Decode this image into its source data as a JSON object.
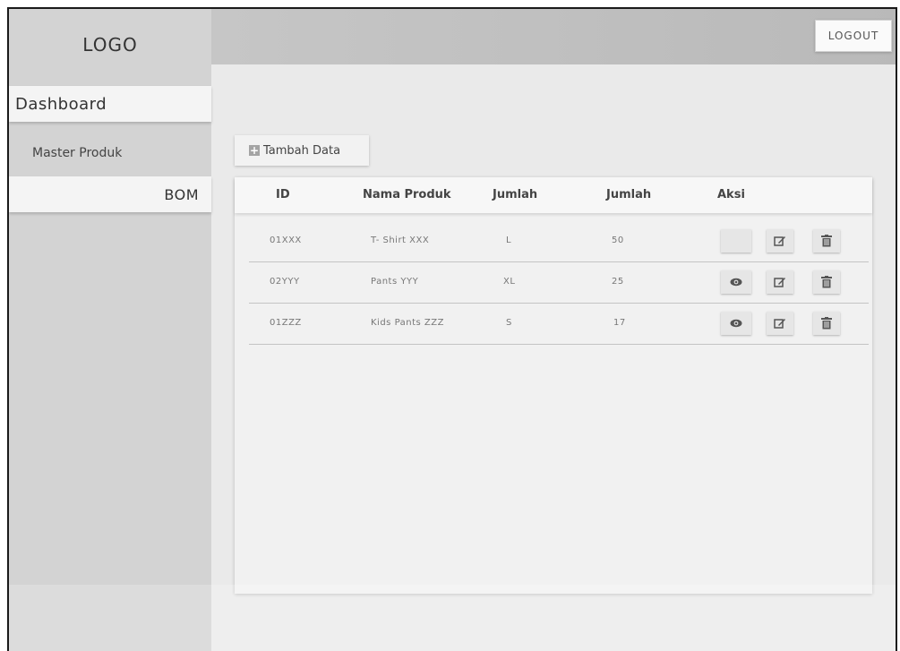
{
  "sidebar": {
    "logo": "LOGO",
    "items": [
      {
        "label": "Dashboard"
      },
      {
        "label": "Master Produk"
      },
      {
        "label": "BOM"
      }
    ]
  },
  "topbar": {
    "logout_label": "LOGOUT"
  },
  "toolbar": {
    "add_label": "Tambah Data",
    "add_icon": "plus-square-icon"
  },
  "table": {
    "columns": [
      "ID",
      "Nama Produk",
      "Jumlah",
      "Jumlah",
      "Aksi"
    ],
    "rows": [
      {
        "id": "01XXX",
        "name": "T- Shirt XXX",
        "size": "L",
        "qty": "50"
      },
      {
        "id": "02YYY",
        "name": "Pants YYY",
        "size": "XL",
        "qty": "25"
      },
      {
        "id": "01ZZZ",
        "name": "Kids Pants ZZZ",
        "size": "S",
        "qty": "17"
      }
    ],
    "actions": [
      "view-icon",
      "edit-icon",
      "trash-icon"
    ]
  },
  "colors": {
    "sidebar_bg": "#d3d3d3",
    "topbar_bg": "#c0c0c0",
    "content_bg": "#eaeaea",
    "card_bg": "#f1f1f1",
    "icon": "#555555"
  }
}
